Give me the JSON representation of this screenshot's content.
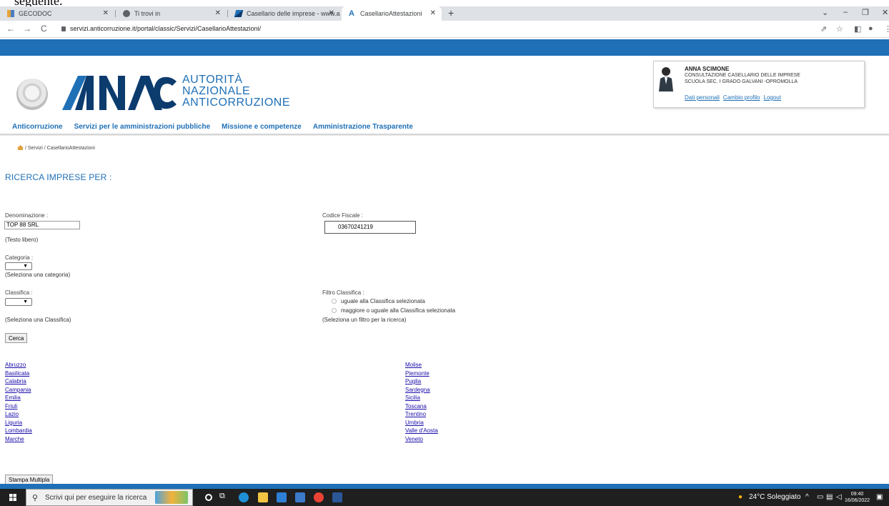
{
  "fragment_text": "seguente.",
  "browser": {
    "tabs": [
      {
        "title": "GECODOC",
        "icon": "gecodoc-icon"
      },
      {
        "title": "Ti trovi in",
        "icon": "globe-icon"
      },
      {
        "title": "Casellario delle imprese - www.a",
        "icon": "anac-icon"
      },
      {
        "title": "CasellarioAttestazioni",
        "icon": "anac-icon",
        "active": true
      }
    ],
    "new_tab": "+",
    "url": "servizi.anticorruzione.it/portal/classic/Servizi/CasellarioAttestazioni/"
  },
  "header": {
    "logo_lines": [
      "AUTORITÀ",
      "NAZIONALE",
      "ANTICORRUZIONE"
    ],
    "user": {
      "name": "ANNA SCIMONE",
      "line1": "CONSULTAZIONE CASELLARIO DELLE IMPRESE",
      "line2": "SCUOLA SEC. I GRADO GALVANI -OPROMOLLA",
      "links": [
        "Dati personali",
        "Cambio profilo",
        "Logout"
      ]
    }
  },
  "menu": [
    "Anticorruzione",
    "Servizi per le amministrazioni pubbliche",
    "Missione e competenze",
    "Amministrazione Trasparente"
  ],
  "breadcrumb": "/ Servizi / CasellarioAttestazioni",
  "page_title": "RICERCA IMPRESE PER :",
  "form": {
    "denominazione_label": "Denominazione :",
    "denominazione_value": "TOP 88 SRL",
    "denominazione_note": "(Testo libero)",
    "codice_fiscale_label": "Codice Fiscale :",
    "codice_fiscale_value": "03670241219",
    "categoria_label": "Categoria :",
    "categoria_note": "(Seleziona una categoria)",
    "classifica_label": "Classifica :",
    "classifica_note": "(Seleziona una Classifica)",
    "filtro_label": "Filtro Classifica :",
    "filtro_options": [
      "uguale alla Classifica selezionata",
      "maggiore o uguale alla Classifica selezionata"
    ],
    "filtro_note": "(Seleziona un filtro per la ricerca)",
    "search_button": "Cerca"
  },
  "regions_left": [
    "Abruzzo",
    "Basilicata",
    "Calabria",
    "Campania",
    "Emilia",
    "Friuli",
    "Lazio",
    "Liguria",
    "Lombardia",
    "Marche"
  ],
  "regions_right": [
    "Molise",
    "Piemonte",
    "Puglia",
    "Sardegna",
    "Sicilia",
    "Toscana",
    "Trentino",
    "Umbria",
    "Valle d'Aosta",
    "Veneto"
  ],
  "print_button": "Stampa Multipla",
  "taskbar": {
    "search_placeholder": "Scrivi qui per eseguire la ricerca",
    "weather": "24°C Soleggiato",
    "time": "09:40",
    "date": "16/06/2022"
  }
}
